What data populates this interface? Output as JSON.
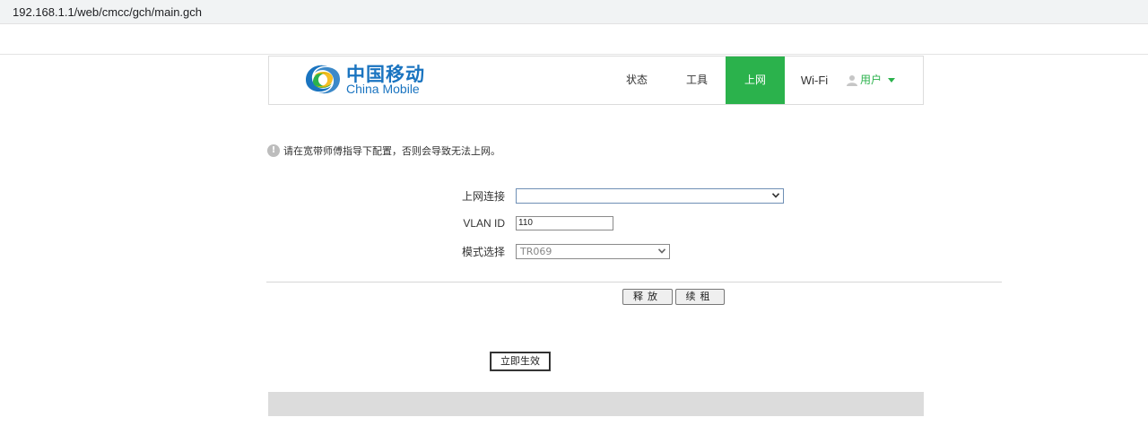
{
  "browser": {
    "url": "192.168.1.1/web/cmcc/gch/main.gch"
  },
  "brand": {
    "name_cn": "中国移动",
    "name_en": "China Mobile",
    "color": "#1a74c0"
  },
  "nav": {
    "items": [
      {
        "label": "状态",
        "active": false
      },
      {
        "label": "工具",
        "active": false
      },
      {
        "label": "上网",
        "active": true
      },
      {
        "label": "Wi-Fi",
        "active": false
      }
    ],
    "user": {
      "label": "用户",
      "icon": "user-icon"
    },
    "active_color": "#2bb24c"
  },
  "notice": {
    "icon": "info-icon",
    "text": "请在宽带师傅指导下配置，否则会导致无法上网。"
  },
  "form": {
    "connection": {
      "label": "上网连接",
      "value": ""
    },
    "vlan": {
      "label": "VLAN ID",
      "value": "110"
    },
    "mode": {
      "label": "模式选择",
      "value": "TR069"
    }
  },
  "actions": {
    "release": "释放",
    "renew": "续租",
    "apply": "立即生效"
  }
}
